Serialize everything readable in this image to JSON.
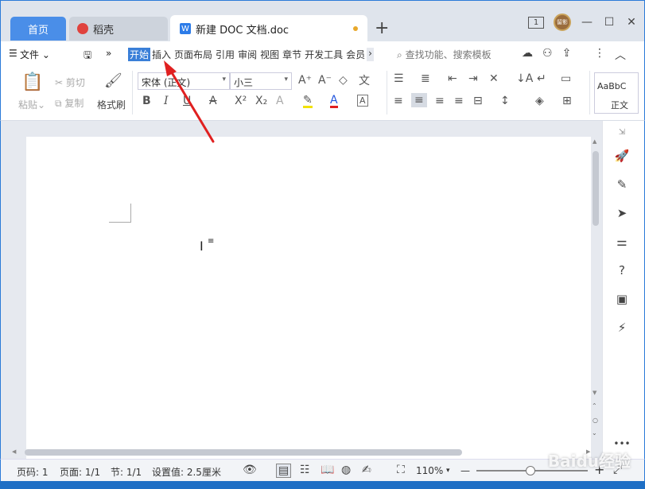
{
  "titlebar": {
    "tabs": [
      {
        "label": "首页"
      },
      {
        "label": "稻壳"
      },
      {
        "label": "新建 DOC 文档.doc"
      }
    ],
    "new_tab": "+",
    "window_count": "1",
    "avatar_text": "留影"
  },
  "menubar": {
    "file": "文件",
    "tabs": [
      "开始",
      "插入",
      "页面布局",
      "引用",
      "审阅",
      "视图",
      "章节",
      "开发工具",
      "会员"
    ],
    "search_placeholder": "查找功能、搜索模板"
  },
  "ribbon": {
    "paste": "粘贴",
    "cut": "剪切",
    "copy": "复制",
    "format_painter": "格式刷",
    "font_name": "宋体 (正文)",
    "font_size": "小三",
    "style_preview": "AaBbC",
    "style_name": "正文"
  },
  "status": {
    "page_no": "页码: 1",
    "pages": "页面: 1/1",
    "section": "节: 1/1",
    "setting": "设置值: 2.5厘米",
    "zoom": "110%"
  },
  "watermark": "Baidu经验",
  "colors": {
    "accent": "#3a7fd8",
    "window_border": "#2b7ad8",
    "annotation": "#e02020"
  }
}
